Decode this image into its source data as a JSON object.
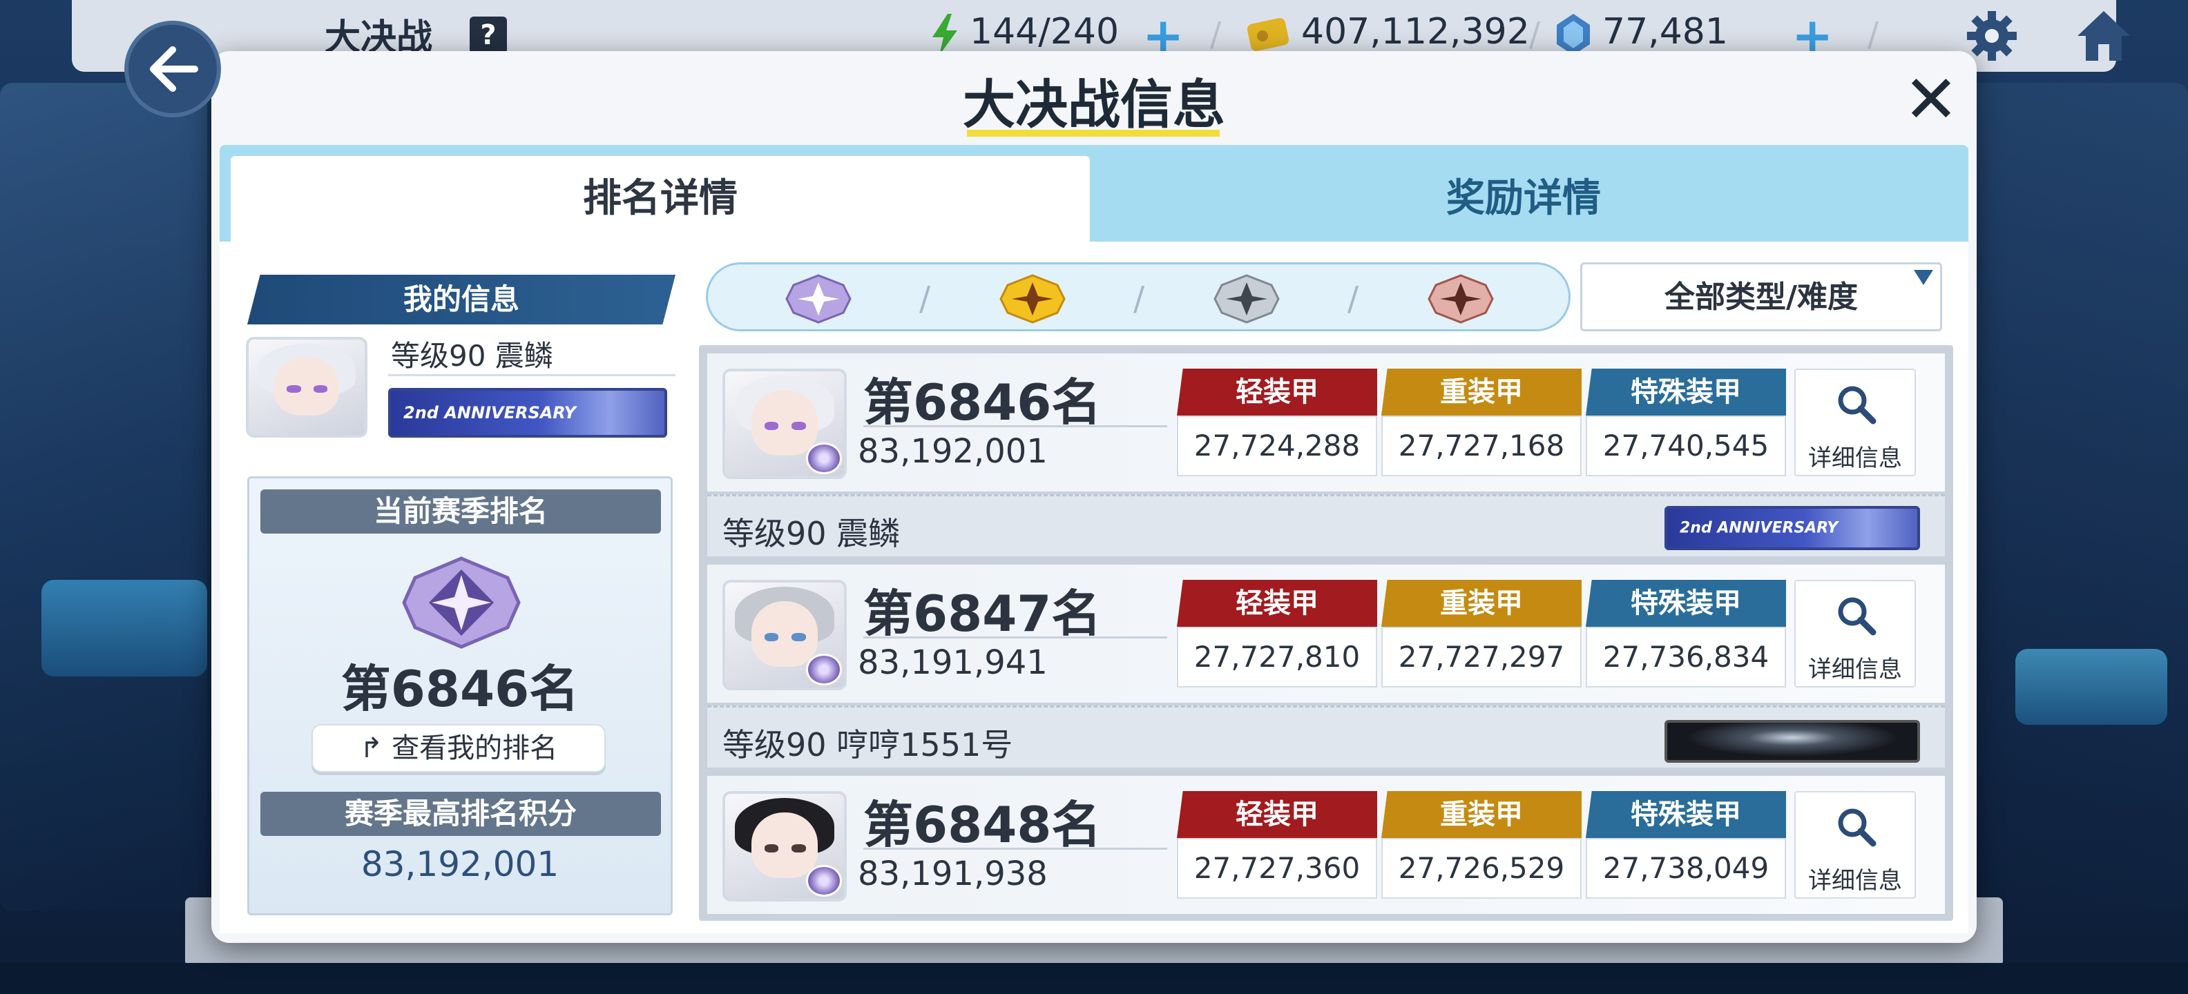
{
  "topbar": {
    "title": "大决战",
    "help": "?",
    "stamina": "144/240",
    "credits": "407,112,392",
    "gems": "77,481",
    "plus": "+",
    "slash": "/"
  },
  "modal": {
    "title": "大决战信息",
    "close": "✕",
    "tabs": [
      "排名详情",
      "奖励详情"
    ]
  },
  "my_info": {
    "header": "我的信息",
    "level_name": "等级90 震鳞",
    "banner_text": "2nd ANNIVERSARY",
    "season_rank_header": "当前赛季排名",
    "season_rank": "第6846名",
    "view_rank_button": "查看我的排名",
    "best_score_header": "赛季最高排名积分",
    "best_score": "83,192,001"
  },
  "filter": {
    "emblems": [
      "purple-emblem-icon",
      "gold-emblem-icon",
      "silver-emblem-icon",
      "bronze-emblem-icon"
    ],
    "separator": "/",
    "type_select": "全部类型/难度"
  },
  "armor_labels": [
    "轻装甲",
    "重装甲",
    "特殊装甲"
  ],
  "armor_colors": [
    "#a21b1f",
    "#c48a12",
    "#2a6d9a"
  ],
  "detail_label": "详细信息",
  "entries": [
    {
      "rank": "第6846名",
      "score": "83,192,001",
      "armor_values": [
        "27,724,288",
        "27,727,168",
        "27,740,545"
      ],
      "level_name": "等级90 震鳞",
      "banner": "2nd ANNIVERSARY",
      "avatar": "white-hair-avatar"
    },
    {
      "rank": "第6847名",
      "score": "83,191,941",
      "armor_values": [
        "27,727,810",
        "27,727,297",
        "27,736,834"
      ],
      "level_name": "等级90 哼哼1551号",
      "banner": "",
      "avatar": "gray-fox-ear-avatar"
    },
    {
      "rank": "第6848名",
      "score": "83,191,938",
      "armor_values": [
        "27,727,360",
        "27,726,529",
        "27,738,049"
      ],
      "avatar": "black-cat-ear-avatar"
    }
  ]
}
